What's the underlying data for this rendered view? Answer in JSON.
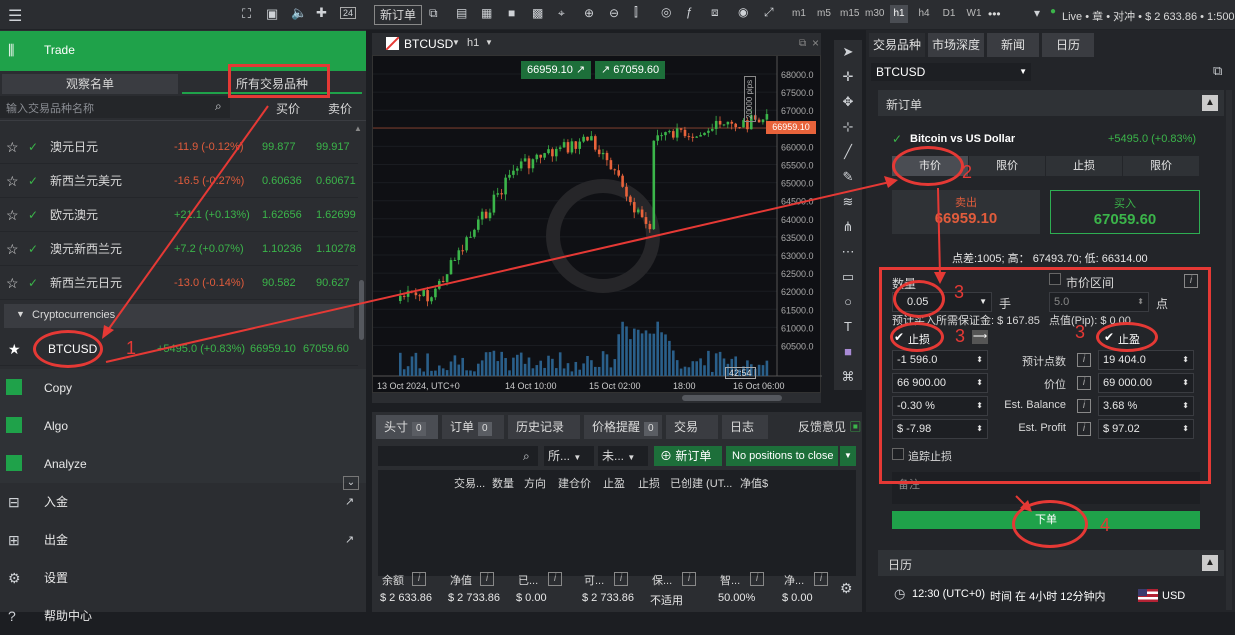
{
  "left": {
    "section": "Trade",
    "tabs": [
      "观察名单",
      "所有交易品种"
    ],
    "search_placeholder": "输入交易品种名称",
    "col_buy": "买价",
    "col_sell": "卖价",
    "rows": [
      {
        "name": "澳元日元",
        "change": "-11.9 (-0.12%)",
        "buy": "99.877",
        "sell": "99.917",
        "dir": "neg"
      },
      {
        "name": "新西兰元美元",
        "change": "-16.5 (-0.27%)",
        "buy": "0.60636",
        "sell": "0.60671",
        "dir": "neg"
      },
      {
        "name": "欧元澳元",
        "change": "+21.1 (+0.13%)",
        "buy": "1.62656",
        "sell": "1.62699",
        "dir": "pos"
      },
      {
        "name": "澳元新西兰元",
        "change": "+7.2 (+0.07%)",
        "buy": "1.10236",
        "sell": "1.10278",
        "dir": "pos"
      },
      {
        "name": "新西兰元日元",
        "change": "-13.0 (-0.14%)",
        "buy": "90.582",
        "sell": "90.627",
        "dir": "neg"
      }
    ],
    "group": "Cryptocurrencies",
    "btc": {
      "name": "BTCUSD",
      "change": "+5495.0 (+0.83%)",
      "buy": "66959.10",
      "sell": "67059.60"
    },
    "menu": [
      "Copy",
      "Algo",
      "Analyze",
      "入金",
      "出金",
      "设置",
      "帮助中心"
    ]
  },
  "toolbar": {
    "new_order": "新订单",
    "timeframes": [
      "m1",
      "m5",
      "m15",
      "m30",
      "h1",
      "h4",
      "D1",
      "W1"
    ],
    "more": "•••",
    "account": "Live • 章 • 对冲 • $ 2 633.86 • 1:500"
  },
  "chart": {
    "symbol": "BTCUSD",
    "tf": "h1",
    "bid_btn": "66959.10",
    "ask_btn": "67059.60",
    "price_tag": "66959.10",
    "pips": "20000 pips",
    "y_ticks": [
      "68000.0",
      "67500.0",
      "67000.0",
      "66500.0",
      "66000.0",
      "65500.0",
      "65000.0",
      "64500.0",
      "64000.0",
      "63500.0",
      "63000.0",
      "62500.0",
      "62000.0",
      "61500.0",
      "61000.0",
      "60500.0"
    ],
    "x_ticks": [
      "13 Oct 2024, UTC+0",
      "14 Oct 10:00",
      "15 Oct 02:00",
      "18:00",
      "16 Oct 06:00"
    ],
    "countdown": "42:54"
  },
  "bottom": {
    "tabs": [
      {
        "label": "头寸",
        "count": "0"
      },
      {
        "label": "订单",
        "count": "0"
      },
      {
        "label": "历史记录",
        "count": ""
      },
      {
        "label": "价格提醒",
        "count": "0"
      },
      {
        "label": "交易",
        "count": ""
      },
      {
        "label": "日志",
        "count": ""
      }
    ],
    "feedback": "反馈意见",
    "filter1": "所...",
    "filter2": "未...",
    "new_order": "新订单",
    "close_all": "No positions to close",
    "cols": [
      "交易...",
      "数量",
      "方向",
      "建仓价",
      "止盈",
      "止损",
      "已创建 (UT...",
      "净值$"
    ],
    "stats": [
      {
        "label": "余额",
        "value": "$ 2 633.86"
      },
      {
        "label": "净值",
        "value": "$ 2 733.86"
      },
      {
        "label": "已...",
        "value": "$ 0.00"
      },
      {
        "label": "可...",
        "value": "$ 2 733.86"
      },
      {
        "label": "保...",
        "value": "不适用"
      },
      {
        "label": "智...",
        "value": "50.00%"
      },
      {
        "label": "净...",
        "value": "$ 0.00"
      }
    ]
  },
  "right": {
    "tabs": [
      "交易品种",
      "市场深度",
      "新闻",
      "日历"
    ],
    "symbol": "BTCUSD",
    "new_order": "新订单",
    "instrument": "Bitcoin vs US Dollar",
    "instrument_change": "+5495.0 (+0.83%)",
    "order_types": [
      "市价",
      "限价",
      "止损",
      "限价"
    ],
    "sell_label": "卖出",
    "sell_price": "66959.10",
    "buy_label": "买入",
    "buy_price": "67059.60",
    "spread": "点差:1005; 高： 67493.70; 低: 66314.00",
    "qty_label": "数量",
    "range_label": "市价区间",
    "qty": "0.05",
    "qty_unit": "手",
    "range_val": "5.0",
    "range_unit": "点",
    "margin": "预计买入所需保证金: $ 167.85",
    "pip_value": "点值(Pip): $ 0.00",
    "sl_label": "止损",
    "tp_label": "止盈",
    "rows": [
      {
        "left": "-1 596.0",
        "label": "预计点数",
        "right": "19 404.0"
      },
      {
        "left": "66 900.00",
        "label": "价位",
        "right": "69 000.00"
      },
      {
        "left": "-0.30 %",
        "label": "Est. Balance",
        "right": "3.68 %"
      },
      {
        "left": "$ -7.98",
        "label": "Est. Profit",
        "right": "$ 97.02"
      }
    ],
    "trailing": "追踪止损",
    "comment": "备注",
    "submit": "下单",
    "calendar": "日历",
    "cal_time": "12:30 (UTC+0)",
    "cal_text": "时间 在 4小时 12分钟内",
    "cal_ccy": "USD"
  },
  "annotations": {
    "n1": "1",
    "n2": "2",
    "n3": "3",
    "n4": "4"
  },
  "colors": {
    "green": "#1fa24a",
    "red": "#e53935",
    "neg": "#e05c3c",
    "pos": "#3bb54a"
  }
}
